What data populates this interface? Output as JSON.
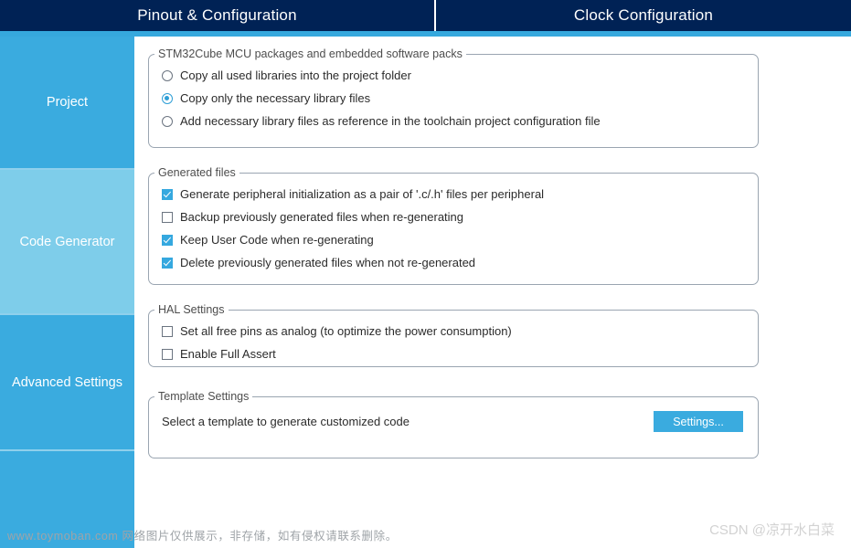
{
  "tabs": [
    {
      "label": "Pinout & Configuration",
      "selected": false
    },
    {
      "label": "Clock Configuration",
      "selected": false
    }
  ],
  "sidebar": {
    "items": [
      {
        "label": "Project",
        "selected": false
      },
      {
        "label": "Code Generator",
        "selected": true
      },
      {
        "label": "Advanced Settings",
        "selected": false
      },
      {
        "label": "",
        "selected": false
      }
    ]
  },
  "groups": {
    "packages": {
      "title": "STM32Cube MCU packages and embedded software packs",
      "options": [
        {
          "label": "Copy all used libraries into the project folder",
          "checked": false
        },
        {
          "label": "Copy only the necessary library files",
          "checked": true
        },
        {
          "label": "Add necessary library files as reference in the toolchain project configuration file",
          "checked": false
        }
      ]
    },
    "generated_files": {
      "title": "Generated files",
      "options": [
        {
          "label": "Generate peripheral initialization as a pair of '.c/.h' files per peripheral",
          "checked": true
        },
        {
          "label": "Backup previously generated files when re-generating",
          "checked": false
        },
        {
          "label": "Keep User Code when re-generating",
          "checked": true
        },
        {
          "label": "Delete previously generated files when not re-generated",
          "checked": true
        }
      ]
    },
    "hal_settings": {
      "title": "HAL Settings",
      "options": [
        {
          "label": "Set all free pins as analog (to optimize the power consumption)",
          "checked": false
        },
        {
          "label": "Enable Full Assert",
          "checked": false
        }
      ]
    },
    "template_settings": {
      "title": "Template Settings",
      "description": "Select a template to generate customized code",
      "button_label": "Settings..."
    }
  },
  "watermarks": {
    "toymoban": "www.toymoban.com 网络图片仅供展示，非存储，如有侵权请联系删除。",
    "csdn": "CSDN @凉开水白菜"
  },
  "colors": {
    "header_bg": "#002255",
    "accent": "#3aabdf",
    "accent_light": "#7ecdea",
    "group_border": "#9aa5b1"
  }
}
